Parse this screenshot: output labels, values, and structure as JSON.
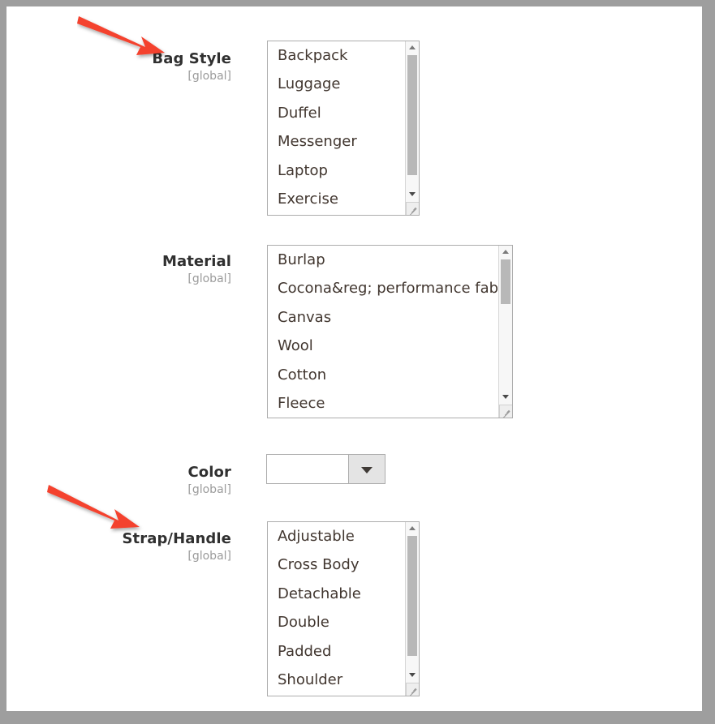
{
  "window": {
    "frame_color": "#9e9e9e",
    "content_background": "#ffffff"
  },
  "annotations": {
    "arrow_color": "#f4422e",
    "arrows": [
      {
        "name": "arrow-pointing-to-bag-style",
        "target_label": "Bag Style"
      },
      {
        "name": "arrow-pointing-to-strap-handle",
        "target_label": "Strap/Handle"
      }
    ]
  },
  "form": {
    "scope_note": "[global]",
    "fields": [
      {
        "key": "bag_style",
        "label": "Bag Style",
        "scope": "[global]",
        "control": "multiselect",
        "options": [
          "Backpack",
          "Luggage",
          "Duffel",
          "Messenger",
          "Laptop",
          "Exercise"
        ],
        "selected": [],
        "scrollbar": {
          "thumb_top_pct": 8,
          "thumb_height_pct": 70
        }
      },
      {
        "key": "material",
        "label": "Material",
        "scope": "[global]",
        "control": "multiselect",
        "options": [
          "Burlap",
          "Cocona&reg; performance fabric",
          "Canvas",
          "Wool",
          "Cotton",
          "Fleece"
        ],
        "selected": [],
        "scrollbar": {
          "thumb_top_pct": 8,
          "thumb_height_pct": 26
        }
      },
      {
        "key": "color",
        "label": "Color",
        "scope": "[global]",
        "control": "select",
        "value": "",
        "placeholder": ""
      },
      {
        "key": "strap_handle",
        "label": "Strap/Handle",
        "scope": "[global]",
        "control": "multiselect",
        "options": [
          "Adjustable",
          "Cross Body",
          "Detachable",
          "Double",
          "Padded",
          "Shoulder"
        ],
        "selected": [],
        "scrollbar": {
          "thumb_top_pct": 8,
          "thumb_height_pct": 70
        }
      }
    ]
  }
}
